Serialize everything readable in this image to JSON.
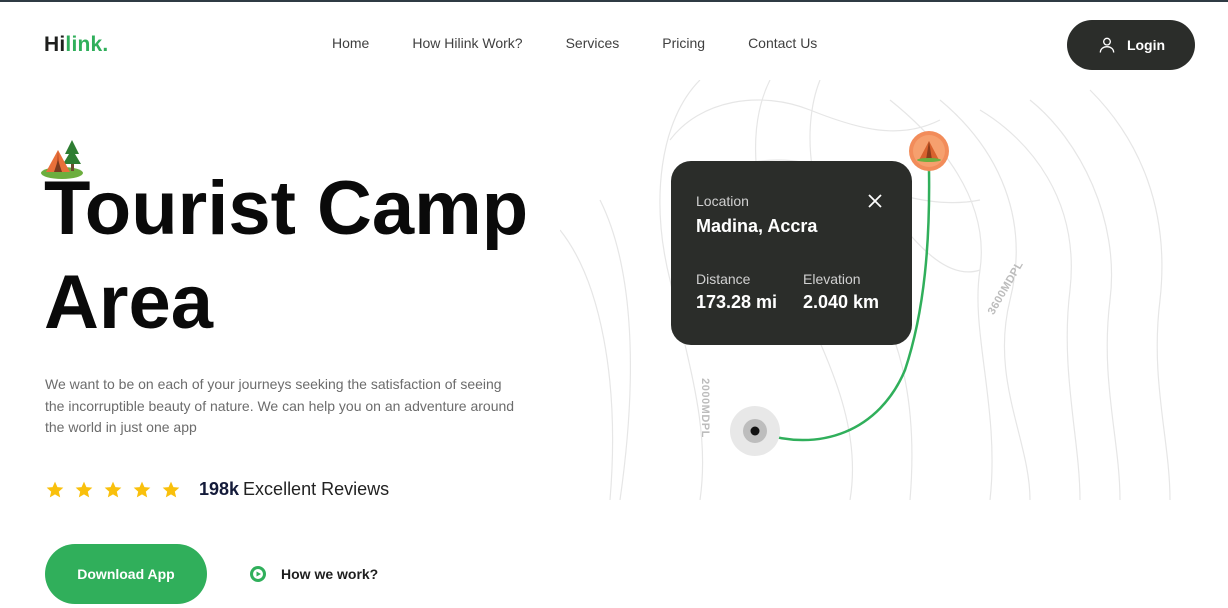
{
  "brand": {
    "logo_dark": "Hi",
    "logo_green": "link."
  },
  "nav": {
    "items": [
      {
        "label": "Home"
      },
      {
        "label": "How Hilink Work?"
      },
      {
        "label": "Services"
      },
      {
        "label": "Pricing"
      },
      {
        "label": "Contact Us"
      }
    ]
  },
  "login": {
    "label": "Login",
    "icon": "user-icon"
  },
  "hero": {
    "title_line1": "Tourist Camp",
    "title_line2": "Area",
    "description": "We want to be on each of your journeys seeking the satisfaction of seeing the incorruptible beauty of nature. We can help you on an adventure around the world in just one app",
    "rating": {
      "stars": 5,
      "count": "198k",
      "text": "Excellent Reviews"
    },
    "download_label": "Download App",
    "how_label": "How we work?"
  },
  "map_card": {
    "location_label": "Location",
    "location_value": "Madina, Accra",
    "distance_label": "Distance",
    "distance_value": "173.28 mi",
    "elevation_label": "Elevation",
    "elevation_value": "2.040 km"
  },
  "map": {
    "elevation_label_1": "3600MDPL",
    "elevation_label_2": "2000MDPL"
  },
  "colors": {
    "accent": "#30af5b",
    "dark": "#2b2d2a",
    "star": "#f9c00c",
    "pin": "#f28c5a"
  }
}
